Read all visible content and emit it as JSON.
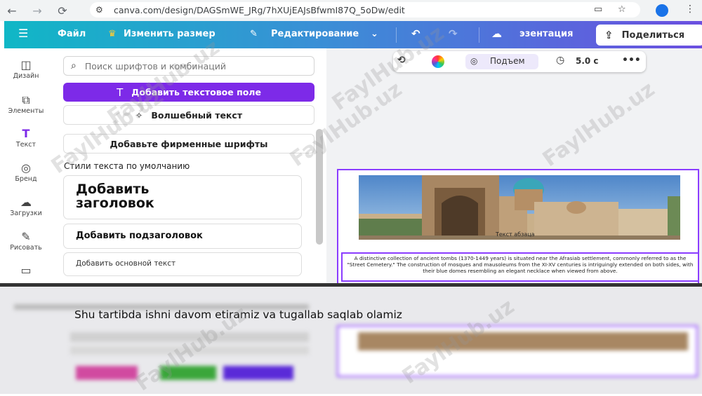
{
  "browser": {
    "url": "canva.com/design/DAGSmWE_JRg/7hXUjEAJsBfwmI87Q_5oDw/edit",
    "back_icon": "arrow-left",
    "forward_icon": "arrow-right",
    "reload_icon": "reload"
  },
  "topbar": {
    "menu_icon": "hamburger",
    "file": "Файл",
    "resize": "Изменить размер",
    "edit": "Редактирование",
    "presentation": "эзентация",
    "share": "Поделиться",
    "gradient_start": "#10b7c6",
    "gradient_end": "#6b4fe0"
  },
  "rail": {
    "items": [
      {
        "label": "Дизайн",
        "icon": "layout-icon"
      },
      {
        "label": "Элементы",
        "icon": "shapes-icon"
      },
      {
        "label": "Текст",
        "icon": "text-icon"
      },
      {
        "label": "Бренд",
        "icon": "brand-icon"
      },
      {
        "label": "Загрузки",
        "icon": "upload-icon"
      },
      {
        "label": "Рисовать",
        "icon": "draw-icon"
      },
      {
        "label": "",
        "icon": "folder-icon"
      }
    ]
  },
  "panel": {
    "search_placeholder": "Поиск шрифтов и комбинаций",
    "add_textbox": "Добавить текстовое поле",
    "magic_text": "Волшебный текст",
    "brand_fonts": "Добавьте фирменные шрифты",
    "default_styles_title": "Стили текста по умолчанию",
    "heading": "Добавить заголовок",
    "subheading": "Добавить подзаголовок",
    "body": "Добавить основной текст",
    "accent": "#7d2ae8"
  },
  "toolbar": {
    "animation": "Подъем",
    "duration": "5.0 с"
  },
  "slide": {
    "caption": "Текст абзаца",
    "paragraph": "A distinctive collection of ancient tombs (1370-1449 years) is situated near the Afrasiab settlement, commonly referred to as the \"Street Cemetery.\" The construction of mosques and mausoleums from the XI-XV centuries is intriguingly extended on both sides, with their blue domes resembling an elegant necklace when viewed from above.",
    "selection_color": "#8b3dff"
  },
  "overlay": {
    "subtitle": "Shu tartibda ishni davom etiramiz va tugallab saqlab olamiz",
    "watermark": "FaylHub.uz"
  }
}
